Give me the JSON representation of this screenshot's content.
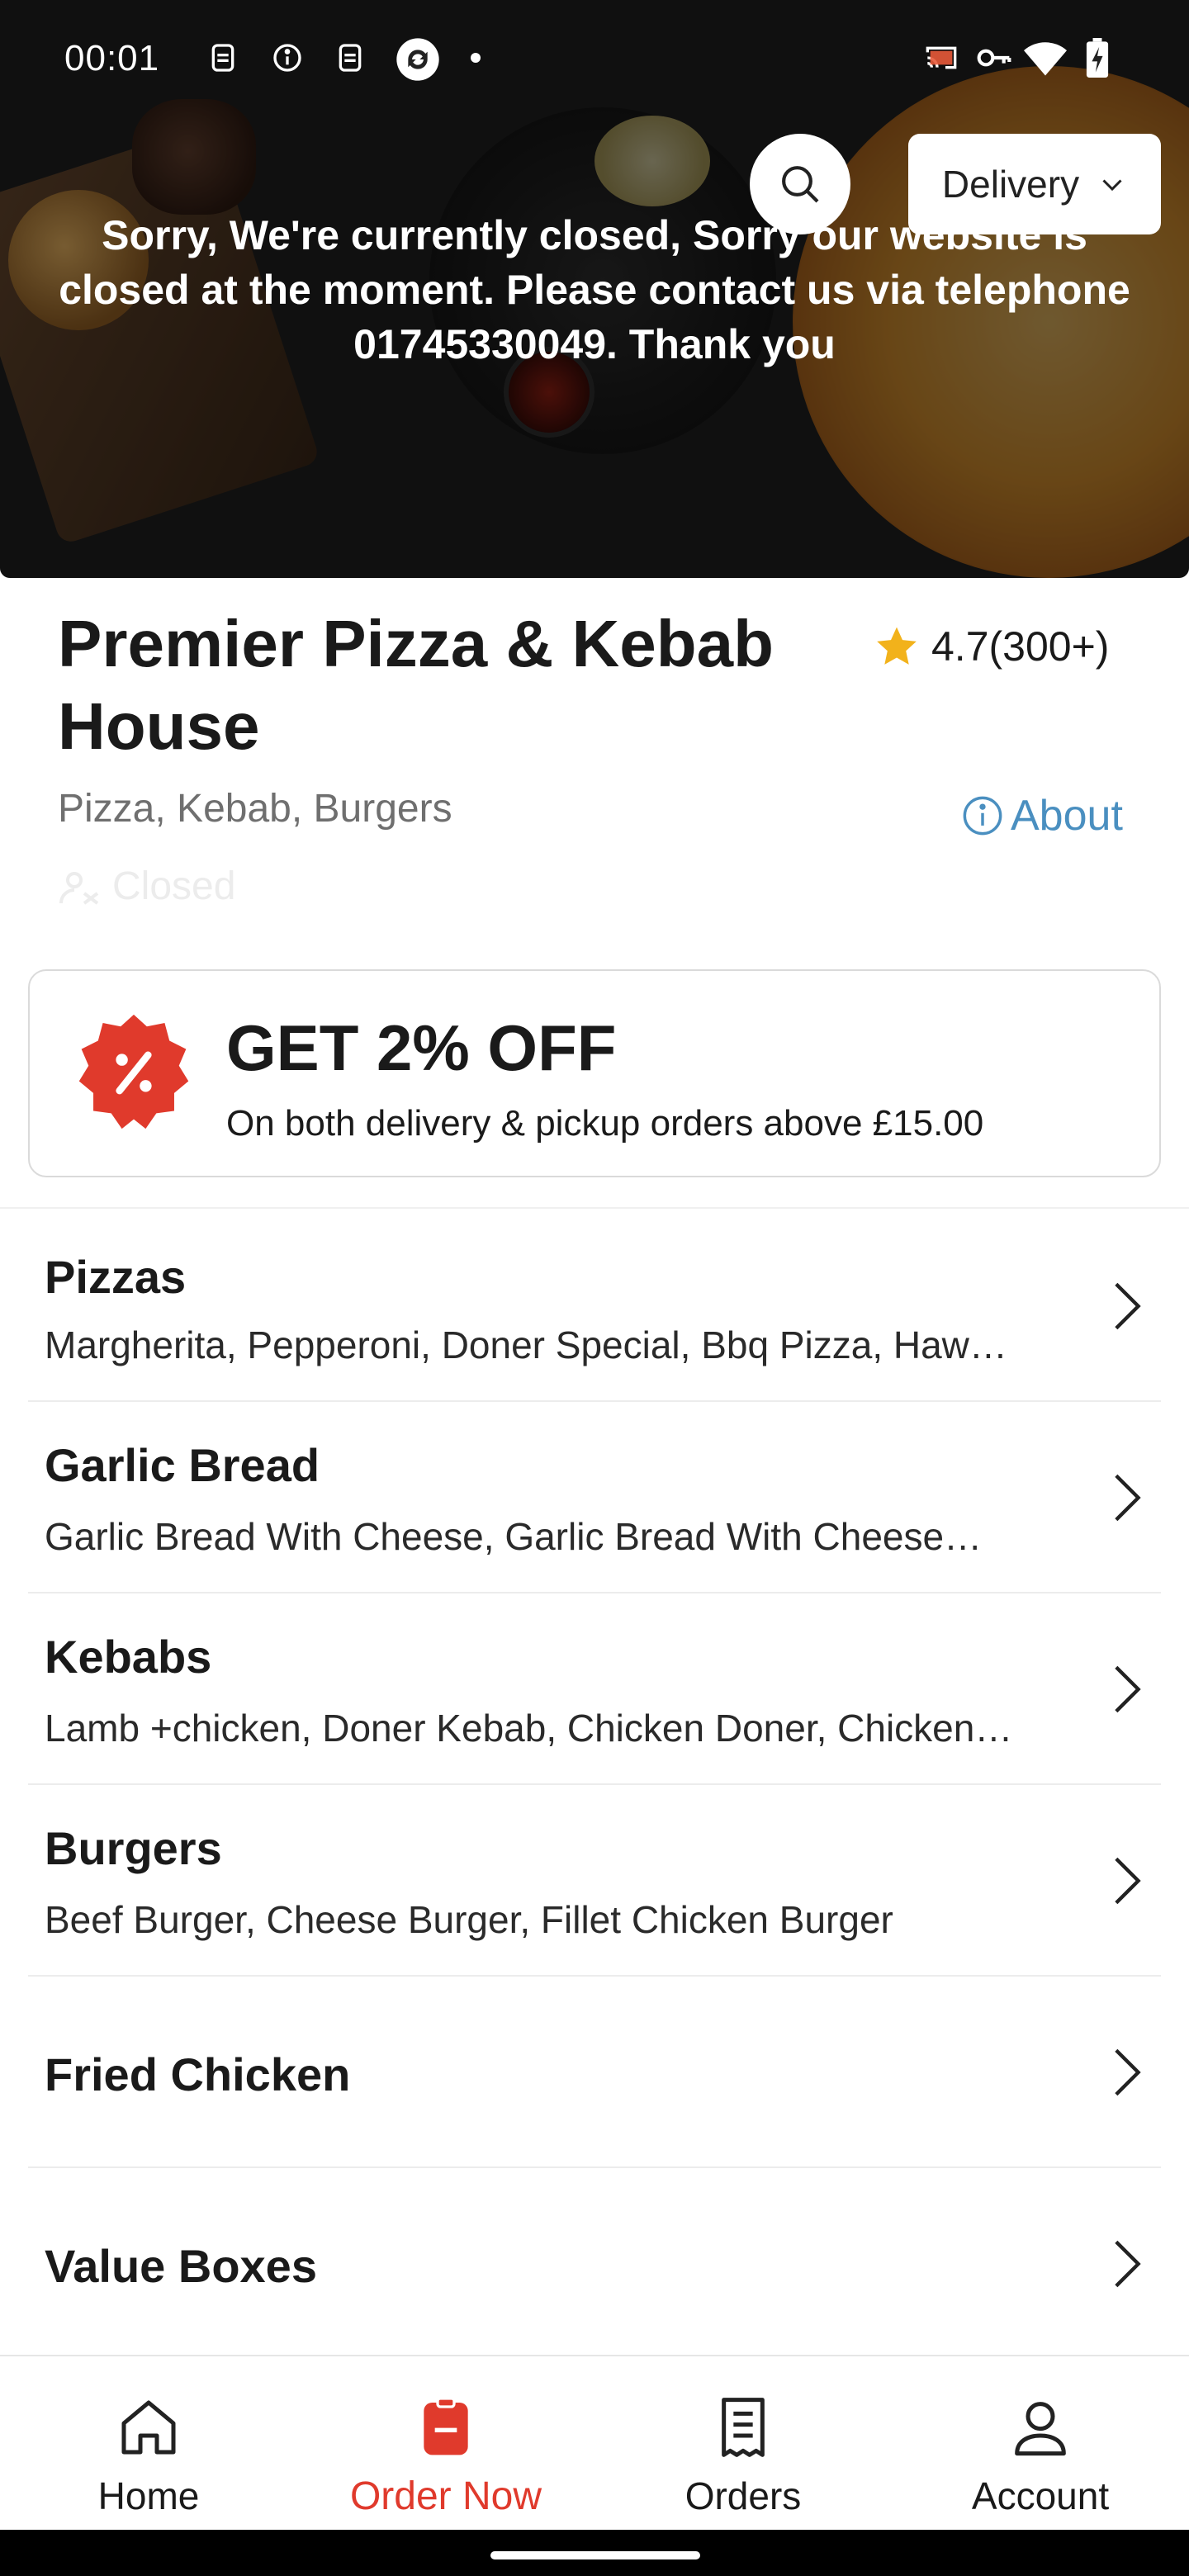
{
  "status_bar": {
    "time": "00:01",
    "left_icons": [
      "sim-icon",
      "info-icon",
      "sim-icon",
      "sync-icon"
    ],
    "right_icons": [
      "cast-icon",
      "vpn-key-icon",
      "wifi-icon",
      "battery-charging-icon"
    ]
  },
  "header": {
    "delivery_mode": "Delivery",
    "closed_message": "Sorry, We're currently closed, Sorry our website is closed at the moment. Please contact us via telephone 01745330049. Thank you"
  },
  "restaurant": {
    "name": "Premier Pizza & Kebab House",
    "rating": "4.7(300+)",
    "cuisines": "Pizza, Kebab, Burgers",
    "about_label": "About",
    "status": "Closed"
  },
  "offer": {
    "title": "GET 2% OFF",
    "subtitle": "On both delivery & pickup orders above £15.00"
  },
  "categories": [
    {
      "name": "Pizzas",
      "items": "Margherita, Pepperoni, Doner Special, Bbq Pizza, Haw…"
    },
    {
      "name": "Garlic Bread",
      "items": "Garlic Bread With Cheese, Garlic Bread With Cheese…"
    },
    {
      "name": "Kebabs",
      "items": "Lamb +chicken, Doner Kebab, Chicken Doner, Chicken…"
    },
    {
      "name": "Burgers",
      "items": "Beef Burger, Cheese Burger, Fillet Chicken Burger"
    },
    {
      "name": "Fried Chicken",
      "items": ""
    },
    {
      "name": "Value Boxes",
      "items": ""
    }
  ],
  "bottom_nav": [
    {
      "label": "Home",
      "icon": "home-icon",
      "active": false
    },
    {
      "label": "Order Now",
      "icon": "order-icon",
      "active": true
    },
    {
      "label": "Orders",
      "icon": "receipt-icon",
      "active": false
    },
    {
      "label": "Account",
      "icon": "account-icon",
      "active": false
    }
  ],
  "colors": {
    "accent": "#e03a2c",
    "link": "#4a8fc0",
    "star": "#f2b21b"
  }
}
